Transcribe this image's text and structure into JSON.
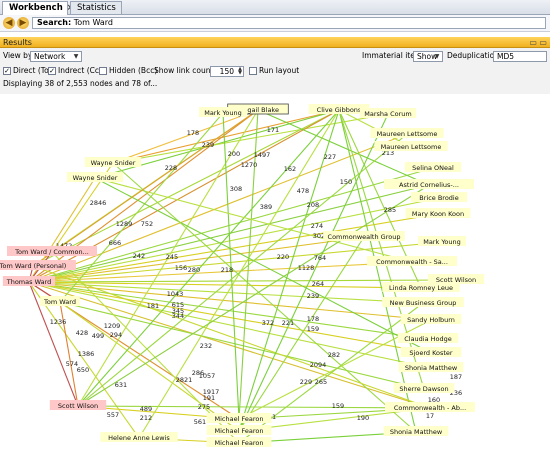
{
  "tabs": [
    {
      "label": "Workbench",
      "close": "×",
      "active": true
    },
    {
      "label": "Statistics",
      "active": false
    }
  ],
  "search": {
    "label": "Search:",
    "value": "Tom Ward"
  },
  "icons": {
    "back": "back-arrow-icon",
    "forward": "forward-arrow-icon"
  },
  "results": {
    "title": "Results",
    "window_controls": "▭ ▭"
  },
  "controls": {
    "view_by_label": "View by:",
    "view_by_value": "Network",
    "immaterial_label": "Immaterial items:",
    "immaterial_value": "Show",
    "dedup_label": "Deduplication:",
    "dedup_value": "MD5",
    "direct_label": "Direct (To)",
    "indirect_label": "Indrect (Cc)",
    "hidden_label": "Hidden (Bcc)",
    "link_count_label": "Show link count",
    "link_count_value": "150",
    "run_layout_label": "Run layout",
    "status": "Displaying 38 of 2,553 nodes and 78 of..."
  },
  "colors": {
    "accent_header": "#f0b020",
    "focus_node": "#ffc8c8",
    "node_fill": "#ffffcc",
    "edge_green": "#7ad03a",
    "edge_yellow": "#d8d020",
    "edge_orange": "#e0902a",
    "edge_red": "#c04848"
  },
  "graph": {
    "nodes": [
      {
        "id": "abigail",
        "label": "Abigail Blake"
      },
      {
        "id": "clive",
        "label": "Clive Gibbons"
      },
      {
        "id": "markyoung1",
        "label": "Mark Young"
      },
      {
        "id": "marsha",
        "label": "Marsha Corum"
      },
      {
        "id": "maureen1",
        "label": "Maureen Lettsome"
      },
      {
        "id": "maureen2",
        "label": "Maureen Lettsome"
      },
      {
        "id": "wayne1",
        "label": "Wayne Snider"
      },
      {
        "id": "wayne2",
        "label": "Wayne Snider"
      },
      {
        "id": "selina",
        "label": "Selina ONeal"
      },
      {
        "id": "astrid",
        "label": "Astrid Cornelius-..."
      },
      {
        "id": "brice",
        "label": "Brice Brodie"
      },
      {
        "id": "marykoon",
        "label": "Mary Koon Koon"
      },
      {
        "id": "cwgroup",
        "label": "Commonwealth Group"
      },
      {
        "id": "markyoung2",
        "label": "Mark Young"
      },
      {
        "id": "tw_common",
        "label": "Tom Ward / Common..."
      },
      {
        "id": "tw_personal",
        "label": "Tom Ward (Personal)"
      },
      {
        "id": "cw_sa",
        "label": "Commonwealth - Sa..."
      },
      {
        "id": "scottw2",
        "label": "Scott Wilson"
      },
      {
        "id": "thomas",
        "label": "Thomas Ward"
      },
      {
        "id": "linda",
        "label": "Linda Romney Leue"
      },
      {
        "id": "tomward",
        "label": "Tom Ward"
      },
      {
        "id": "nbg",
        "label": "New Business Group"
      },
      {
        "id": "sandy",
        "label": "Sandy Holburn"
      },
      {
        "id": "claudia",
        "label": "Claudia Hodge"
      },
      {
        "id": "sjoerd",
        "label": "Sjoerd Koster"
      },
      {
        "id": "shonia1",
        "label": "Shonia Matthew"
      },
      {
        "id": "sherre",
        "label": "Sherre Dawson"
      },
      {
        "id": "scottw",
        "label": "Scott Wilson"
      },
      {
        "id": "michael1",
        "label": "Michael Fearon"
      },
      {
        "id": "cw_ab",
        "label": "Commonwealth - Ab..."
      },
      {
        "id": "helene",
        "label": "Helene Anne Lewis"
      },
      {
        "id": "michael2",
        "label": "Michael Fearon"
      },
      {
        "id": "shonia2",
        "label": "Shonia Matthew"
      },
      {
        "id": "michael3",
        "label": "Michael Fearon"
      }
    ],
    "edges": [
      {
        "a": "wayne1",
        "b": "abigail",
        "c": "#f0c040"
      },
      {
        "a": "wayne1",
        "b": "clive",
        "c": "#e8a030"
      },
      {
        "a": "wayne2",
        "b": "clive",
        "c": "#7ad03a"
      },
      {
        "a": "wayne1",
        "b": "marsha",
        "c": "#b8e040"
      },
      {
        "a": "tw_common",
        "b": "wayne1",
        "c": "#d8d020"
      },
      {
        "a": "tw_common",
        "b": "abigail",
        "c": "#b8e040"
      },
      {
        "a": "tw_personal",
        "b": "clive",
        "c": "#a8d838"
      },
      {
        "a": "thomas",
        "b": "maureen1",
        "c": "#e0c030"
      },
      {
        "a": "thomas",
        "b": "abigail",
        "c": "#e09030"
      },
      {
        "a": "thomas",
        "b": "clive",
        "c": "#d89030"
      },
      {
        "a": "thomas",
        "b": "selina",
        "c": "#9ad840"
      },
      {
        "a": "thomas",
        "b": "astrid",
        "c": "#8ad040"
      },
      {
        "a": "thomas",
        "b": "brice",
        "c": "#b8e040"
      },
      {
        "a": "thomas",
        "b": "marykoon",
        "c": "#d8d020"
      },
      {
        "a": "thomas",
        "b": "cwgroup",
        "c": "#e0c030"
      },
      {
        "a": "thomas",
        "b": "markyoung2",
        "c": "#c8d830"
      },
      {
        "a": "thomas",
        "b": "cw_sa",
        "c": "#e8c838"
      },
      {
        "a": "thomas",
        "b": "scottw2",
        "c": "#a8d838"
      },
      {
        "a": "thomas",
        "b": "linda",
        "c": "#d8d020"
      },
      {
        "a": "thomas",
        "b": "nbg",
        "c": "#b8e040"
      },
      {
        "a": "thomas",
        "b": "sandy",
        "c": "#e0c030"
      },
      {
        "a": "thomas",
        "b": "claudia",
        "c": "#9ad840"
      },
      {
        "a": "thomas",
        "b": "sjoerd",
        "c": "#d8d020"
      },
      {
        "a": "thomas",
        "b": "shonia1",
        "c": "#b8e040"
      },
      {
        "a": "thomas",
        "b": "scottw",
        "c": "#c05050"
      },
      {
        "a": "thomas",
        "b": "michael1",
        "c": "#e09030"
      },
      {
        "a": "thomas",
        "b": "helene",
        "c": "#c8d830"
      },
      {
        "a": "thomas",
        "b": "cw_ab",
        "c": "#d8c030"
      },
      {
        "a": "tomward",
        "b": "scottw",
        "c": "#e08030"
      },
      {
        "a": "tomward",
        "b": "michael2",
        "c": "#c8d830"
      },
      {
        "a": "tomward",
        "b": "sherre",
        "c": "#9ad840"
      },
      {
        "a": "tomward",
        "b": "markyoung1",
        "c": "#9ad840"
      },
      {
        "a": "scottw",
        "b": "michael1",
        "c": "#d8d020"
      },
      {
        "a": "scottw",
        "b": "clive",
        "c": "#7ad03a"
      },
      {
        "a": "scottw",
        "b": "cw_ab",
        "c": "#9ad840"
      },
      {
        "a": "scottw",
        "b": "abigail",
        "c": "#b8e040"
      },
      {
        "a": "helene",
        "b": "clive",
        "c": "#b8e040"
      },
      {
        "a": "helene",
        "b": "michael3",
        "c": "#d8d020"
      },
      {
        "a": "michael1",
        "b": "cw_ab",
        "c": "#9ad840"
      },
      {
        "a": "michael2",
        "b": "cw_ab",
        "c": "#b8e040"
      },
      {
        "a": "michael3",
        "b": "shonia2",
        "c": "#7ad03a"
      },
      {
        "a": "michael1",
        "b": "abigail",
        "c": "#8ad040"
      },
      {
        "a": "michael2",
        "b": "clive",
        "c": "#7ad03a"
      },
      {
        "a": "abigail",
        "b": "astrid",
        "c": "#7ad03a"
      },
      {
        "a": "clive",
        "b": "shonia2",
        "c": "#7ad03a"
      },
      {
        "a": "clive",
        "b": "sherre",
        "c": "#9ad840"
      },
      {
        "a": "clive",
        "b": "maureen2",
        "c": "#b8e040"
      },
      {
        "a": "clive",
        "b": "linda",
        "c": "#9ad840"
      },
      {
        "a": "markyoung1",
        "b": "michael1",
        "c": "#7ad03a"
      },
      {
        "a": "wayne2",
        "b": "cw_sa",
        "c": "#b8e040"
      },
      {
        "a": "wayne2",
        "b": "sjoerd",
        "c": "#7ad03a"
      },
      {
        "a": "wayne1",
        "b": "shonia2",
        "c": "#9ad840"
      },
      {
        "a": "tw_personal",
        "b": "cw_ab",
        "c": "#c8d830"
      },
      {
        "a": "tw_personal",
        "b": "abigail",
        "c": "#e0a030"
      },
      {
        "a": "tw_common",
        "b": "michael3",
        "c": "#b8e040"
      },
      {
        "a": "cwgroup",
        "b": "michael2",
        "c": "#9ad840"
      },
      {
        "a": "astrid",
        "b": "scottw",
        "c": "#8ad040"
      },
      {
        "a": "sandy",
        "b": "michael1",
        "c": "#b8e040"
      },
      {
        "a": "nbg",
        "b": "michael3",
        "c": "#9ad840"
      },
      {
        "a": "marsha",
        "b": "michael2",
        "c": "#7ad03a"
      },
      {
        "a": "maureen1",
        "b": "scottw",
        "c": "#9ad840"
      },
      {
        "a": "thomas",
        "b": "wayne2",
        "c": "#e0c030"
      },
      {
        "a": "thomas",
        "b": "tomward",
        "c": "#c05050"
      },
      {
        "a": "tw_common",
        "b": "thomas",
        "c": "#c05050"
      },
      {
        "a": "tw_personal",
        "b": "thomas",
        "c": "#c05050"
      }
    ],
    "edge_labels": [
      "178",
      "171",
      "239",
      "200",
      "1497",
      "1270",
      "162",
      "227",
      "150",
      "213",
      "228",
      "2846",
      "308",
      "478",
      "389",
      "208",
      "285",
      "1289",
      "752",
      "274",
      "302",
      "666",
      "1472",
      "242",
      "245",
      "156",
      "280",
      "218",
      "220",
      "764",
      "1128",
      "264",
      "239",
      "1043",
      "615",
      "345",
      "344",
      "181",
      "372",
      "221",
      "178",
      "159",
      "1236",
      "428",
      "499",
      "1209",
      "294",
      "1386",
      "574",
      "650",
      "232",
      "282",
      "2094",
      "286",
      "1057",
      "2821",
      "631",
      "1917",
      "229",
      "265",
      "191",
      "275",
      "187",
      "236",
      "160",
      "489",
      "212",
      "557",
      "561",
      "251",
      "159",
      "190",
      "277",
      "856",
      "17"
    ]
  }
}
